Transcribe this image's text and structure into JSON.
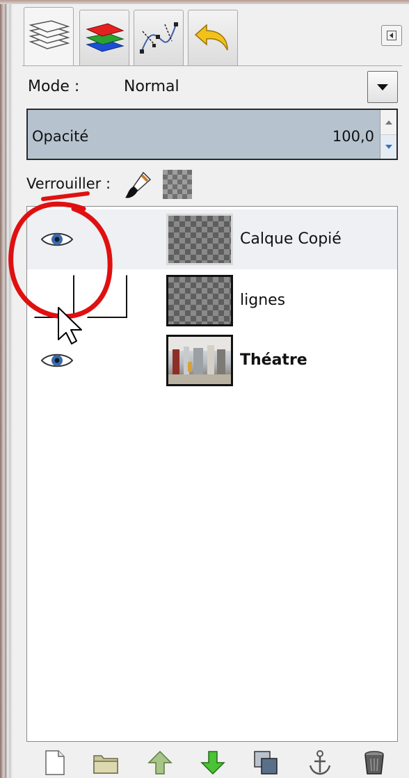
{
  "tabs": [
    {
      "name": "layers-tab",
      "icon": "layers-icon",
      "active": true
    },
    {
      "name": "channels-tab",
      "icon": "channels-icon",
      "active": false
    },
    {
      "name": "paths-tab",
      "icon": "paths-icon",
      "active": false
    },
    {
      "name": "undo-history-tab",
      "icon": "undo-icon",
      "active": false
    }
  ],
  "mode": {
    "label": "Mode :",
    "value": "Normal"
  },
  "opacity": {
    "label": "Opacité",
    "value": "100,0",
    "percent": 100
  },
  "lock": {
    "label": "Verrouiller :"
  },
  "layers": [
    {
      "name": "Calque Copié",
      "visible": true,
      "selected": true,
      "bold": false,
      "thumb": "transparent"
    },
    {
      "name": "lignes",
      "visible": false,
      "selected": false,
      "bold": false,
      "thumb": "transparent"
    },
    {
      "name": "Théatre",
      "visible": true,
      "selected": false,
      "bold": true,
      "thumb": "photo"
    }
  ],
  "toolbar": [
    "new-layer-icon",
    "new-layer-group-icon",
    "raise-layer-icon",
    "lower-layer-icon",
    "duplicate-layer-icon",
    "anchor-layer-icon",
    "delete-layer-icon"
  ],
  "colors": {
    "accent": "#b6c3cf",
    "annotation": "#e01010",
    "raise_arrow": "#7fa45a",
    "lower_arrow": "#3aa62c"
  }
}
